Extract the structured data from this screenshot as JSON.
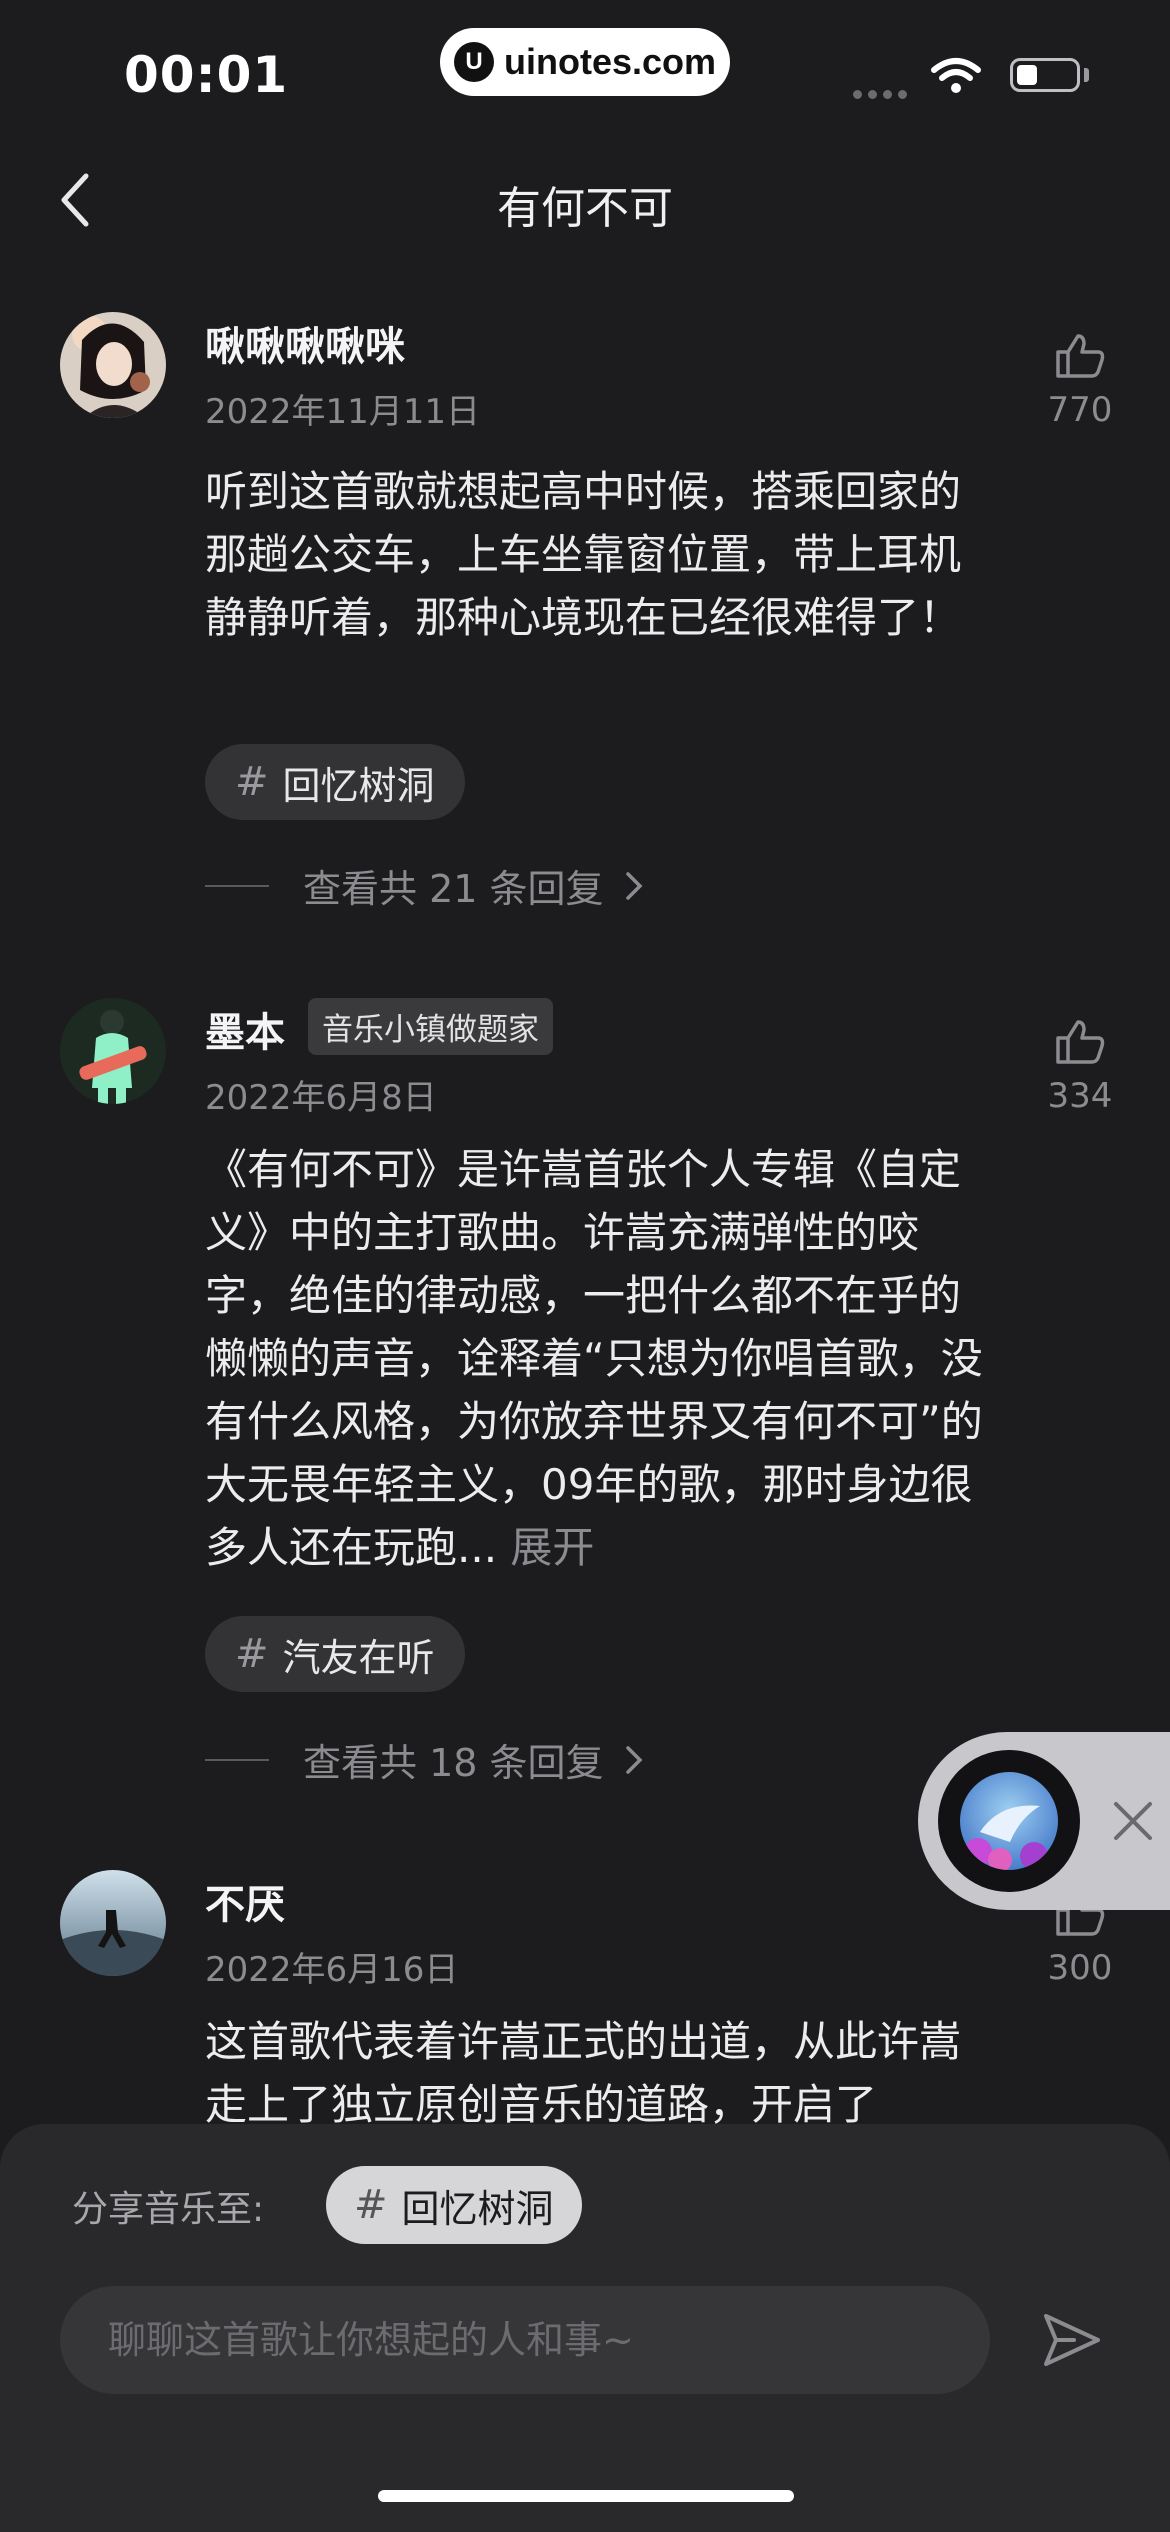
{
  "status_bar": {
    "time": "00:01",
    "watermark": "uinotes.com",
    "watermark_logo": "U"
  },
  "nav": {
    "title": "有何不可"
  },
  "comments": [
    {
      "username": "啾啾啾啾咪",
      "badge": "",
      "date": "2022年11月11日",
      "likes": "770",
      "text": "听到这首歌就想起高中时候，搭乘回家的那趟公交车，上车坐靠窗位置，带上耳机静静听着，那种心境现在已经很难得了！",
      "tag": "回忆树洞",
      "replies": "查看共 21 条回复"
    },
    {
      "username": "墨本",
      "badge": "音乐小镇做题家",
      "date": "2022年6月8日",
      "likes": "334",
      "text": "《有何不可》是许嵩首张个人专辑《自定义》中的主打歌曲。许嵩充满弹性的咬字，绝佳的律动感，一把什么都不在乎的懒懒的声音，诠释着“只想为你唱首歌，没有什么风格，为你放弃世界又有何不可”的大无畏年轻主义，09年的歌，那时身边很多人还在玩跑...",
      "expand": "展开",
      "tag": "汽友在听",
      "replies": "查看共 18 条回复"
    },
    {
      "username": "不厌",
      "badge": "",
      "date": "2022年6月16日",
      "likes": "300",
      "text": "这首歌代表着许嵩正式的出道，从此许嵩走上了独立原创音乐的道路，开启了"
    }
  ],
  "share": {
    "label": "分享音乐至:",
    "tag": "回忆树洞"
  },
  "input": {
    "placeholder": "聊聊这首歌让你想起的人和事~"
  },
  "colors": {
    "background": "#1c1c1e",
    "panel": "#29292b",
    "chip": "#333335",
    "muted_text": "#8c8c90"
  }
}
